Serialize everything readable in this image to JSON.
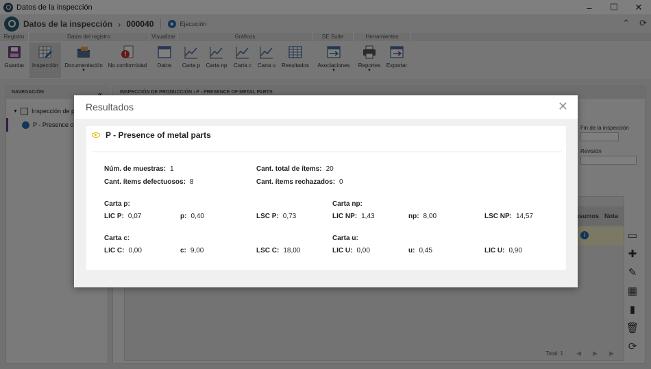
{
  "window": {
    "title": "Datos de la inspección",
    "minimize": "–",
    "maximize": "☐",
    "close": "✕"
  },
  "header": {
    "crumb": "Datos de la inspección",
    "separator": "›",
    "code": "000040",
    "status": "Ejecución",
    "collapse_icon": "⌃",
    "refresh_icon": "⟳"
  },
  "ribbon": {
    "groups": [
      "Registro",
      "Datos del registro",
      "Visualizar",
      "Gráficos",
      "SE Suite",
      "Herramientas"
    ],
    "buttons": [
      {
        "label": "Guardar",
        "icon": "save-icon",
        "color": "#7a3f86"
      },
      {
        "label": "Inspección",
        "icon": "grid-edit-icon",
        "color": "#6f7c8c"
      },
      {
        "label": "Documentación",
        "icon": "folder-icon",
        "color": "#3d5a80"
      },
      {
        "label": "No conformidad",
        "icon": "warning-doc-icon",
        "color": "#c0392b"
      },
      {
        "label": "Datos",
        "icon": "window-icon",
        "color": "#4a6fa5"
      },
      {
        "label": "Carta p",
        "icon": "line-chart-icon",
        "color": "#4a6fa5"
      },
      {
        "label": "Carta np",
        "icon": "line-chart-icon",
        "color": "#4a6fa5"
      },
      {
        "label": "Carta c",
        "icon": "line-chart-icon",
        "color": "#4a6fa5"
      },
      {
        "label": "Carta u",
        "icon": "line-chart-icon",
        "color": "#4a6fa5"
      },
      {
        "label": "Resultados",
        "icon": "table-icon",
        "color": "#4a6fa5"
      },
      {
        "label": "Asociaciones",
        "icon": "link-icon",
        "color": "#2e7d6b"
      },
      {
        "label": "Reportes",
        "icon": "printer-icon",
        "color": "#555"
      },
      {
        "label": "Exportar",
        "icon": "export-icon",
        "color": "#4a6fa5"
      }
    ]
  },
  "nav": {
    "title": "NAVEGACIÓN",
    "collapse": "«",
    "items": [
      "Inspección de producción",
      "P - Presence of metal parts"
    ]
  },
  "content": {
    "breadcrumb": "INSPECCIÓN DE PRODUCCIÓN  ›  P - PRESENCE OF METAL PARTS",
    "fin_label": "Fin de la inspección",
    "revision_label": "Revisión",
    "col_insumos": "Insumos",
    "col_nota": "Nota",
    "total": "Total: 1",
    "info": "i"
  },
  "modal": {
    "title": "Resultados",
    "close": "✕",
    "item_title": "P - Presence of metal parts",
    "stats": {
      "num_muestras_label": "Núm. de muestras:",
      "num_muestras": "1",
      "cant_total_label": "Cant. total de ítems:",
      "cant_total": "20",
      "defectuosos_label": "Cant. ítems defectuosos:",
      "defectuosos": "8",
      "rechazados_label": "Cant. ítems rechazados:",
      "rechazados": "0"
    },
    "carta_p": {
      "title": "Carta p:",
      "lic_label": "LIC P:",
      "lic": "0,07",
      "val_label": "p:",
      "val": "0,40",
      "lsc_label": "LSC P:",
      "lsc": "0,73"
    },
    "carta_np": {
      "title": "Carta np:",
      "lic_label": "LIC NP:",
      "lic": "1,43",
      "val_label": "np:",
      "val": "8,00",
      "lsc_label": "LSC NP:",
      "lsc": "14,57"
    },
    "carta_c": {
      "title": "Carta c:",
      "lic_label": "LIC C:",
      "lic": "0,00",
      "val_label": "c:",
      "val": "9,00",
      "lsc_label": "LSC C:",
      "lsc": "18,00"
    },
    "carta_u": {
      "title": "Carta u:",
      "lic_label": "LIC U:",
      "lic": "0,00",
      "val_label": "u:",
      "val": "0,45",
      "lsc_label": "LIC U:",
      "lsc": "0,90"
    }
  }
}
